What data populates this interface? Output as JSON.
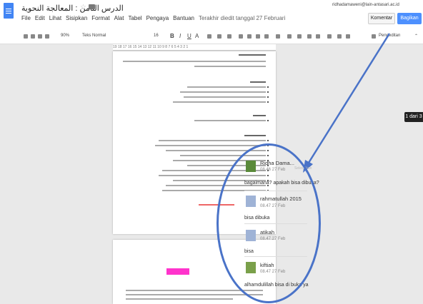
{
  "header": {
    "title": "الدرس الثامن : المعالجة النحوية",
    "menu": [
      "File",
      "Edit",
      "Lihat",
      "Sisipkan",
      "Format",
      "Alat",
      "Tabel",
      "Pengaya",
      "Bantuan"
    ],
    "last_edit": "Terakhir diedit tanggal 27 Februari",
    "email": "ridhadamaweni@lain-antasari.ac.id",
    "comment_button": "Komentar",
    "share_button": "Bagikan"
  },
  "toolbar": {
    "zoom": "90%",
    "style": "Teks Normal",
    "font_size": "16",
    "bold": "B",
    "italic": "I",
    "underline": "U",
    "text_color": "A",
    "mode": "Pengeditan"
  },
  "ruler": "19 18 17 16 15 14 13 12 11 10 9 8 7 6 5 4 3 2 1",
  "page_count": "1 dari 3",
  "comments": [
    {
      "name": "Ridha Dama...",
      "time": "08.46 27 Feb",
      "text": "bagaimana? apakah bisa dibuka?",
      "color": "#5a8a3a"
    },
    {
      "name": "rahmatullah 2015",
      "time": "08.47 27 Feb",
      "text": "bisa dibuka",
      "color": "#9fb3d6"
    },
    {
      "name": "atikah",
      "time": "08.47 27 Feb",
      "text": "bisa",
      "color": "#9fb3d6"
    },
    {
      "name": "kiftiah",
      "time": "08.47 27 Feb",
      "text": "alhamdulillah bisa di buka ya",
      "color": "#7aa04a"
    }
  ],
  "resolve_label": "Selesaikan",
  "colors": {
    "share": "#4d90fe",
    "annotation": "#4a73c8",
    "highlight": "#ff33cc"
  }
}
